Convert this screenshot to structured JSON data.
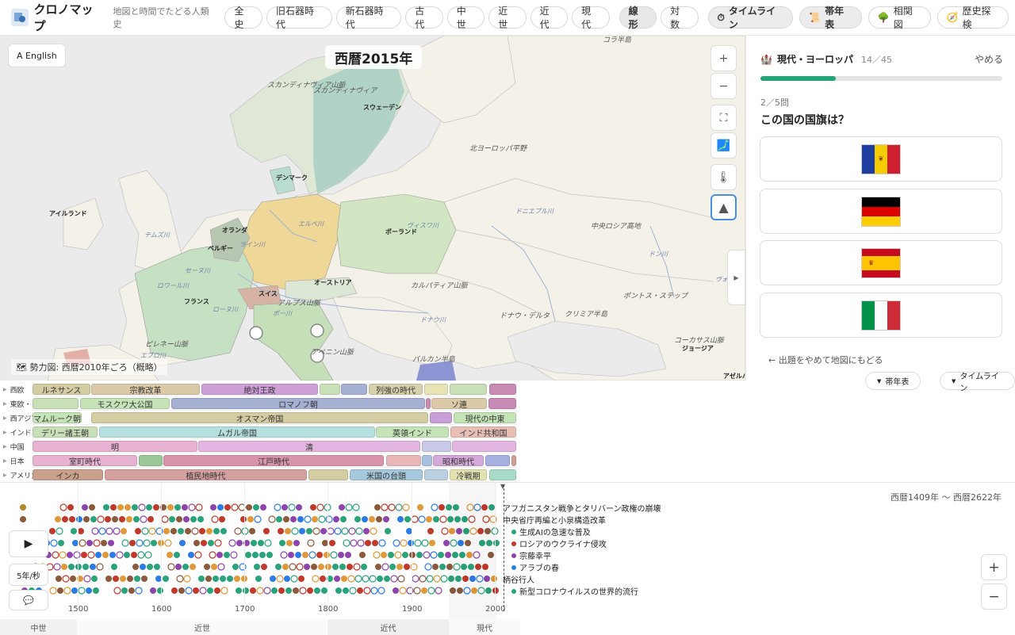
{
  "header": {
    "app_title": "クロノマップ",
    "tagline": "地図と時間でたどる人類史",
    "eras": [
      "全史",
      "旧石器時代",
      "新石器時代",
      "古代",
      "中世",
      "近世",
      "近代",
      "現代"
    ],
    "scale_linear": "線形",
    "scale_log": "対数",
    "tool_timeline": "タイムライン",
    "tool_bandchart": "帯年表",
    "tool_relations": "相関図",
    "tool_explore": "歴史探検"
  },
  "map": {
    "english_toggle": "A English",
    "year_label": "西暦2015年",
    "legend": "🗺 勢力図: 西暦2010年ごろ（概略）",
    "zoom_in": "+",
    "zoom_out": "−",
    "labels": {
      "scandinavia1": "スカンディナヴィア山脈",
      "scandinavia2": "スカンディナヴィア",
      "sweden": "スウェーデン",
      "north_plain": "北ヨーロッパ平野",
      "denmark": "デンマーク",
      "ireland": "アイルランド",
      "thames": "テムズ川",
      "elbe": "エルベ川",
      "vistula": "ヴィスワ川",
      "poland": "ポーランド",
      "netherlands": "オランダ",
      "rhine": "ライン川",
      "belgium": "ベルギー",
      "seine": "セーヌ川",
      "loire": "ロワール川",
      "france": "フランス",
      "rhone": "ローヌ川",
      "swiss": "スイス",
      "alps": "アルプス山脈",
      "austria": "オーストリア",
      "po": "ポー川",
      "carpathian": "カルパティア山脈",
      "danube": "ドナウ川",
      "dnieper": "ドニエプル川",
      "central_russia": "中央ロシア高地",
      "don": "ドン川",
      "volga": "ヴォル",
      "pontic": "ポントス・ステップ",
      "danube_delta": "ドナウ・デルタ",
      "crimea": "クリミア半島",
      "pyrenees": "ピレネー山脈",
      "ebro": "エブロ川",
      "apennine": "アペニン山脈",
      "balkan": "バルカン半島",
      "caucasus": "コーカサス山脈",
      "georgia": "ジョージア",
      "azerbaijan": "アゼルバ",
      "kola": "コラ半島"
    }
  },
  "quiz": {
    "title": "現代・ヨーロッパ",
    "count": "14／45",
    "quit": "やめる",
    "progress": 0.31,
    "step": "2／5問",
    "question": "この国の国旗は？",
    "options": [
      "moldova-flag",
      "germany-flag",
      "spain-flag",
      "italy-flag"
    ],
    "back": "← 出題をやめて地図にもどる"
  },
  "toggles": {
    "band": "帯年表",
    "timeline": "タイムライン"
  },
  "bands": {
    "rows": [
      {
        "label": "西欧",
        "segs": [
          {
            "t": "ルネサンス",
            "c": "#d4cda4"
          },
          {
            "t": "宗教改革",
            "c": "#dcc9a8"
          },
          {
            "t": "絶対王政",
            "c": "#cfa0d8"
          },
          {
            "t": "",
            "c": "#c8dfb7"
          },
          {
            "t": "",
            "c": "#a6b0d3"
          },
          {
            "t": "列強の時代",
            "c": "#d7d2ae"
          },
          {
            "t": "",
            "c": "#e7e3b5"
          },
          {
            "t": "",
            "c": "#c8dfb7"
          },
          {
            "t": "",
            "c": "#c88bb3"
          }
        ]
      },
      {
        "label": "東欧・ロシア",
        "segs": [
          {
            "t": "",
            "c": "#c8dfb7"
          },
          {
            "t": "モスクワ大公国",
            "c": "#c4e3b6"
          },
          {
            "t": "ロマノフ朝",
            "c": "#a6b0d3"
          },
          {
            "t": "",
            "c": "#c88bb3"
          },
          {
            "t": "ソ連",
            "c": "#dcc9a8"
          },
          {
            "t": "",
            "c": "#c88bb3"
          }
        ]
      },
      {
        "label": "西アジア",
        "segs": [
          {
            "t": "マムルーク朝",
            "c": "#c4e3b6"
          },
          {
            "t": "オスマン帝国",
            "c": "#d4cda4"
          },
          {
            "t": "",
            "c": "#c8a0d8"
          },
          {
            "t": "現代の中東",
            "c": "#c4e3b6"
          }
        ]
      },
      {
        "label": "インド",
        "segs": [
          {
            "t": "デリー諸王朝",
            "c": "#c8dfb7"
          },
          {
            "t": "ムガル帝国",
            "c": "#b6e0e0"
          },
          {
            "t": "英領インド",
            "c": "#c4e3b6"
          },
          {
            "t": "インド共和国",
            "c": "#e7bfb5"
          }
        ]
      },
      {
        "label": "中国",
        "segs": [
          {
            "t": "明",
            "c": "#e8b2d2"
          },
          {
            "t": "清",
            "c": "#e2b6e0"
          },
          {
            "t": "",
            "c": "#c8c8e8"
          },
          {
            "t": "",
            "c": "#e2b6e0"
          }
        ]
      },
      {
        "label": "日本",
        "segs": [
          {
            "t": "室町時代",
            "c": "#e8b2d2"
          },
          {
            "t": "",
            "c": "#9bc79b"
          },
          {
            "t": "江戸時代",
            "c": "#d895aa"
          },
          {
            "t": "",
            "c": "#e8b8b8"
          },
          {
            "t": "",
            "c": "#a8c0e0"
          },
          {
            "t": "昭和時代",
            "c": "#d4a8d8"
          },
          {
            "t": "",
            "c": "#a6b0e0"
          },
          {
            "t": "",
            "c": "#d0a098"
          }
        ]
      },
      {
        "label": "アメリカ大陸",
        "segs": [
          {
            "t": "インカ",
            "c": "#c9a08c"
          },
          {
            "t": "植民地時代",
            "c": "#d4a0a0"
          },
          {
            "t": "",
            "c": "#d4cda4"
          },
          {
            "t": "米国の台頭",
            "c": "#a6c8dc"
          },
          {
            "t": "",
            "c": "#b8d0e0"
          },
          {
            "t": "冷戦期",
            "c": "#e2e2b0"
          },
          {
            "t": "",
            "c": "#a8dcc8"
          }
        ]
      }
    ]
  },
  "timeline": {
    "range": "西暦1409年 〜 西暦2622年",
    "speed": "5年/秒",
    "events": [
      {
        "t": "アフガニスタン戦争とタリバーン政権の崩壊",
        "c": ""
      },
      {
        "t": "中央省庁再編と小泉構造改革",
        "c": ""
      },
      {
        "t": "生成AIの急速な普及",
        "c": "#2aa37a"
      },
      {
        "t": "ロシアのウクライナ侵攻",
        "c": "#c0392b"
      },
      {
        "t": "宗藤幸平",
        "c": "#8e44ad"
      },
      {
        "t": "アラブの春",
        "c": "#2c7be5"
      },
      {
        "t": "柄谷行人",
        "c": ""
      },
      {
        "t": "新型コロナウイルスの世界的流行",
        "c": "#2aa37a"
      }
    ],
    "ticks": [
      "1500",
      "1600",
      "1700",
      "1800",
      "1900",
      "2000"
    ],
    "eras": [
      "中世",
      "近世",
      "近代",
      "現代"
    ]
  }
}
